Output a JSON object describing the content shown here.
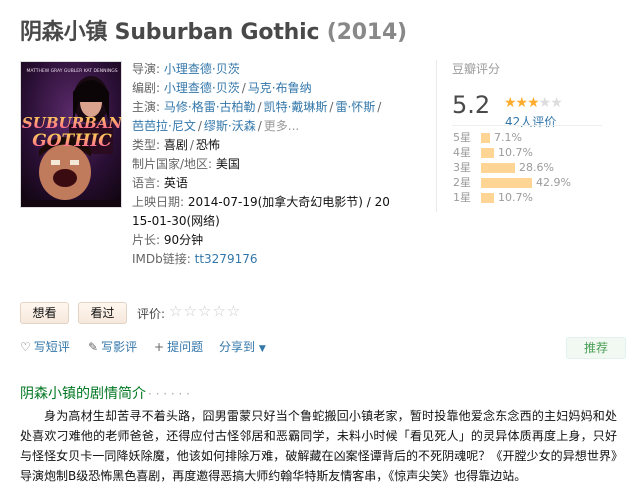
{
  "title": {
    "cn": "阴森小镇",
    "en": "Suburban Gothic",
    "year": "(2014)"
  },
  "poster": {
    "top_names": "MATTHEW GRAY GUBLER   KAT DENNINGS",
    "title_line1": "SUBURBAN",
    "title_line2": "GOTHIC"
  },
  "info": {
    "director_label": "导演",
    "director": "小理查德·贝茨",
    "writer_label": "编剧",
    "writers": [
      "小理查德·贝茨",
      "马克·布鲁纳"
    ],
    "cast_label": "主演",
    "cast_line1": [
      "马修·格雷·古柏勒",
      "凯特·戴琳斯",
      "雷·怀斯"
    ],
    "cast_line2": [
      "芭芭拉·尼文",
      "缪斯·沃森"
    ],
    "more": "更多...",
    "genre_label": "类型:",
    "genres": [
      "喜剧",
      "恐怖"
    ],
    "country_label": "制片国家/地区:",
    "country": "美国",
    "language_label": "语言:",
    "language": "英语",
    "release_label": "上映日期:",
    "release_1": "2014-07-19(加拿大奇幻电影节)",
    "release_sep": " / 20",
    "release_2": "15-01-30(网络)",
    "runtime_label": "片长:",
    "runtime": "90分钟",
    "imdb_label": "IMDb链接:",
    "imdb": "tt3279176"
  },
  "rating": {
    "label": "豆瓣评分",
    "score": "5.2",
    "stars_on": "★★★",
    "stars_off": "★★",
    "votes": "42人评价",
    "distribution": [
      {
        "label": "5星",
        "pct_text": "7.1%",
        "pct": 7.1
      },
      {
        "label": "4星",
        "pct_text": "10.7%",
        "pct": 10.7
      },
      {
        "label": "3星",
        "pct_text": "28.6%",
        "pct": 28.6
      },
      {
        "label": "2星",
        "pct_text": "42.9%",
        "pct": 42.9
      },
      {
        "label": "1星",
        "pct_text": "10.7%",
        "pct": 10.7
      }
    ]
  },
  "buttons": {
    "want": "想看",
    "seen": "看过",
    "rate_label": "评价:",
    "rate_stars": "☆☆☆☆☆"
  },
  "actions": {
    "short_review": "写短评",
    "review": "写影评",
    "ask": "提问题",
    "share": "分享到",
    "share_caret": "▼",
    "recommend": "推荐"
  },
  "section": {
    "title": "阴森小镇的剧情简介",
    "dots": "· · · · · ·"
  },
  "summary": "身为高材生却苦寻不着头路，囧男雷蒙只好当个鲁蛇搬回小镇老家，暂时投靠他爱念东念西的主妇妈妈和处处喜欢刁难他的老师爸爸，还得应付古怪邻居和恶霸同学，未料小时候「看见死人」的灵异体质再度上身，只好与怪怪女贝卡一同降妖除魔，他该如何排除万难，破解藏在凶案怪谭背后的不死阴魂呢？《开膛少女的异想世界》导演炮制B级恐怖黑色喜剧，再度邀得恶搞大师约翰华特斯友情客串，《惊声尖笑》也得靠边站。",
  "colors": {
    "link": "#3377aa",
    "star": "#ffac2d",
    "bar": "#ffd596",
    "section": "#007722",
    "recommend": "#499f55"
  }
}
